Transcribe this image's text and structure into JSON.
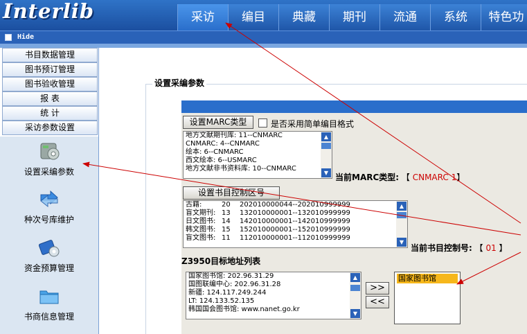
{
  "app": {
    "logo": "Interlib"
  },
  "nav": {
    "tabs": [
      "采访",
      "编目",
      "典藏",
      "期刊",
      "流通",
      "系统",
      "特色功"
    ]
  },
  "hidebar": {
    "label": "Hide"
  },
  "sidebar": {
    "menu": [
      "书目数据管理",
      "图书预订管理",
      "图书验收管理",
      "报 表",
      "统 计",
      "采访参数设置"
    ],
    "icons": [
      {
        "label": "设置采编参数",
        "icon": "settings-disc-icon"
      },
      {
        "label": "种次号库维护",
        "icon": "blue-arrows-icon"
      },
      {
        "label": "资金预算管理",
        "icon": "budget-icon"
      },
      {
        "label": "书商信息管理",
        "icon": "folder-icon"
      }
    ]
  },
  "content": {
    "section_title": "设置采编参数",
    "marc": {
      "button": "设置MARC类型",
      "checkbox_label": "是否采用简单编目格式",
      "list": [
        "地方文献期刊库:   11--CNMARC",
        "CNMARC:  4--CNMARC",
        "绘本:  6--CNMARC",
        "西文绘本:  6--USMARC",
        "地方文献非书资料库:  10--CNMARC"
      ],
      "current_label": "当前MARC类型:",
      "current_value": "CNMARC 1"
    },
    "control": {
      "button": "设置书目控制区号",
      "list": [
        {
          "name": "古籍:",
          "code": "20",
          "range": "202010000044--202010999999"
        },
        {
          "name": "盲文期刊:",
          "code": "13",
          "range": "132010000001--132010999999"
        },
        {
          "name": "日文图书:",
          "code": "14",
          "range": "142010000001--142010999999"
        },
        {
          "name": "韩文图书:",
          "code": "15",
          "range": "152010000001--152010999999"
        },
        {
          "name": "盲文图书:",
          "code": "11",
          "range": "112010000001--112010999999"
        }
      ],
      "current_label": "当前书目控制号:",
      "current_value": "01"
    },
    "z3950": {
      "title": "Z3950目标地址列表",
      "list": [
        "国家图书馆: 202.96.31.29",
        "国图联编中心: 202.96.31.28",
        "新疆: 124.117.249.244",
        "LT: 124.133.52.135",
        "韩国国会图书馆: www.nanet.go.kr"
      ],
      "add_button": ">>",
      "remove_button": "<<",
      "selected": [
        "国家图书馆"
      ]
    }
  },
  "colors": {
    "header_blue": "#1b4fa0",
    "annotation_red": "#cc0000",
    "selection_orange": "#f6b71b"
  }
}
